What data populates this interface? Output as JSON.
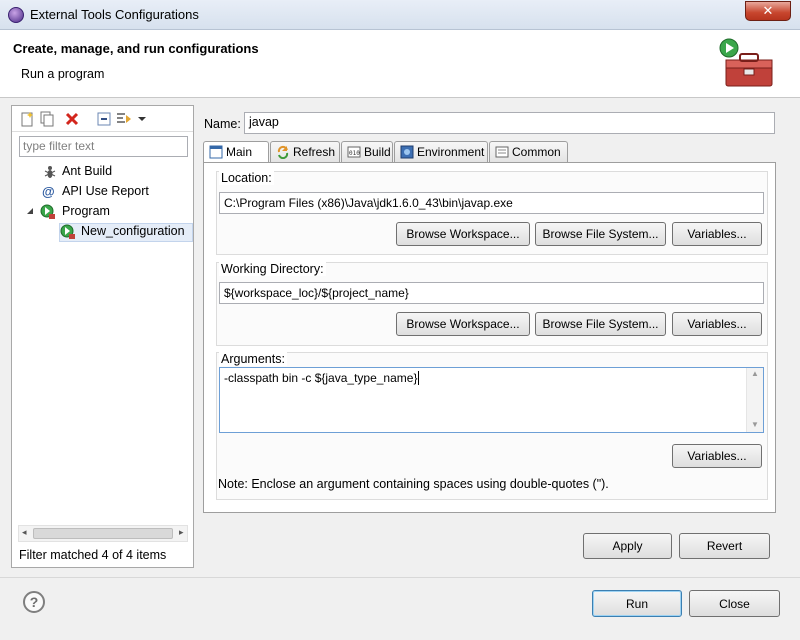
{
  "window": {
    "title": "External Tools Configurations",
    "close_label": "✕"
  },
  "banner": {
    "title": "Create, manage, and run configurations",
    "subtitle": "Run a program"
  },
  "left": {
    "filter_placeholder": "type filter text",
    "tree": [
      {
        "label": "Ant Build",
        "icon": "ant-icon"
      },
      {
        "label": "API Use Report",
        "icon": "api-report-icon"
      },
      {
        "label": "Program",
        "icon": "program-icon",
        "expanded": true
      },
      {
        "label": "New_configuration",
        "icon": "program-config-icon",
        "selected": true
      }
    ],
    "status": "Filter matched 4 of 4 items"
  },
  "config": {
    "name_label": "Name:",
    "name_value": "javap",
    "tabs": [
      {
        "label": "Main",
        "icon": "main-tab-icon",
        "active": true
      },
      {
        "label": "Refresh",
        "icon": "refresh-tab-icon"
      },
      {
        "label": "Build",
        "icon": "build-tab-icon"
      },
      {
        "label": "Environment",
        "icon": "environment-tab-icon"
      },
      {
        "label": "Common",
        "icon": "common-tab-icon"
      }
    ],
    "location": {
      "title": "Location:",
      "value": "C:\\Program Files (x86)\\Java\\jdk1.6.0_43\\bin\\javap.exe",
      "browse_workspace": "Browse Workspace...",
      "browse_fs": "Browse File System...",
      "variables": "Variables..."
    },
    "workdir": {
      "title": "Working Directory:",
      "value": "${workspace_loc}/${project_name}",
      "browse_workspace": "Browse Workspace...",
      "browse_fs": "Browse File System...",
      "variables": "Variables..."
    },
    "arguments": {
      "title": "Arguments:",
      "value": "-classpath bin -c ${java_type_name}",
      "variables": "Variables..."
    },
    "note": "Note: Enclose an argument containing spaces using double-quotes (\").",
    "apply": "Apply",
    "revert": "Revert"
  },
  "footer": {
    "help": "?",
    "run": "Run",
    "close": "Close"
  },
  "colors": {
    "selection": "#e5edf8",
    "toolbox_red": "#c0413a",
    "run_green": "#3aa64a"
  }
}
